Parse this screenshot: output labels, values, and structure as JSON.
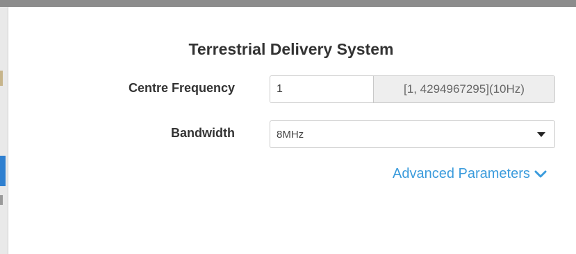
{
  "dialog": {
    "title": "Terrestrial Delivery System"
  },
  "centre_frequency": {
    "label": "Centre Frequency",
    "value": "1",
    "range_hint": "[1, 4294967295](10Hz)"
  },
  "bandwidth": {
    "label": "Bandwidth",
    "selected": "8MHz"
  },
  "advanced": {
    "label": "Advanced Parameters",
    "icon": "chevron-down-icon"
  },
  "colors": {
    "link": "#3a9bdc",
    "text": "#333333",
    "addon_bg": "#eeeeee",
    "side_accent": "#2f80d0"
  }
}
